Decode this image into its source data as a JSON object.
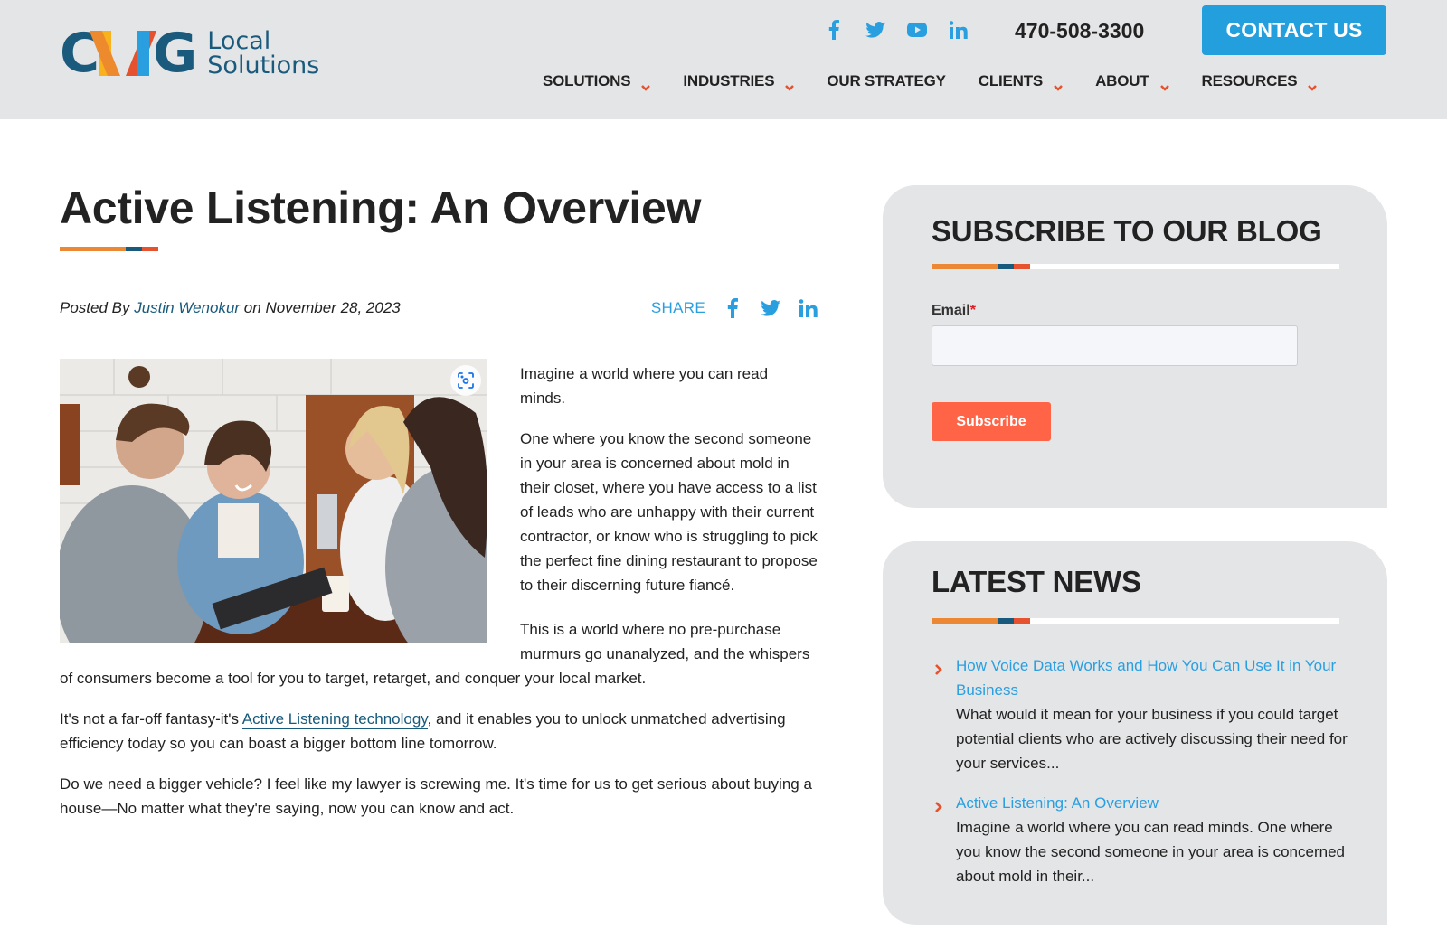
{
  "brand": {
    "logo_letters": [
      "C",
      "G"
    ],
    "logo_text_line1": "Local",
    "logo_text_line2": "Solutions",
    "colors": {
      "navy": "#1a5a7c",
      "orange": "#ec8733",
      "red": "#e5522d",
      "blue": "#239fde",
      "yellow": "#f7b21c",
      "subscribe": "#ff6446"
    }
  },
  "header": {
    "social": [
      {
        "name": "facebook-icon",
        "glyph": "f"
      },
      {
        "name": "twitter-icon",
        "glyph": "twitter"
      },
      {
        "name": "youtube-icon",
        "glyph": "youtube"
      },
      {
        "name": "linkedin-icon",
        "glyph": "in"
      }
    ],
    "phone": "470-508-3300",
    "contact_label": "CONTACT US",
    "nav": [
      {
        "label": "SOLUTIONS",
        "dropdown": true
      },
      {
        "label": "INDUSTRIES",
        "dropdown": true
      },
      {
        "label": "OUR STRATEGY",
        "dropdown": false
      },
      {
        "label": "CLIENTS",
        "dropdown": true
      },
      {
        "label": "ABOUT",
        "dropdown": true
      },
      {
        "label": "RESOURCES",
        "dropdown": true
      }
    ]
  },
  "article": {
    "title": "Active Listening: An Overview",
    "posted_prefix": "Posted By ",
    "author": "Justin Wenokur",
    "posted_mid": " on ",
    "date": "November 28, 2023",
    "share_label": "SHARE",
    "image_alt": "Four young people smiling around a table with a tablet and coffee",
    "paragraphs": {
      "p1": "Imagine a world where you can read minds.",
      "p2": "One where you know the second someone in your area is concerned about mold in their closet, where you have access to a list of leads who are unhappy with their current contractor, or know who is struggling to pick the perfect fine dining restaurant to propose to their discerning future fiancé.",
      "p3": "This is a world where no pre-purchase murmurs go unanalyzed, and the whispers of consumers become a tool for you to target, retarget, and conquer your local market.",
      "p4_before": "It's not a far-off fantasy-it's ",
      "p4_link": "Active Listening technology",
      "p4_after": ", and it enables you to unlock unmatched advertising efficiency today so you can boast a bigger bottom line tomorrow.",
      "p5": "Do we need a bigger vehicle? I feel like my lawyer is screwing me. It's time for us to get serious about buying a house—No matter what they're saying, now you can know and act."
    }
  },
  "sidebar": {
    "subscribe": {
      "title": "SUBSCRIBE TO OUR BLOG",
      "email_label": "Email",
      "required_mark": "*",
      "email_value": "",
      "email_placeholder": "",
      "button_label": "Subscribe"
    },
    "news": {
      "title": "LATEST NEWS",
      "items": [
        {
          "title": "How Voice Data Works and How You Can Use It in Your Business",
          "excerpt": "What would it mean for your business if you could target potential clients who are actively discussing their need for your services..."
        },
        {
          "title": "Active Listening: An Overview",
          "excerpt": "Imagine a world where you can read minds. One where you know the second someone in your area is concerned about mold in their..."
        }
      ]
    }
  }
}
